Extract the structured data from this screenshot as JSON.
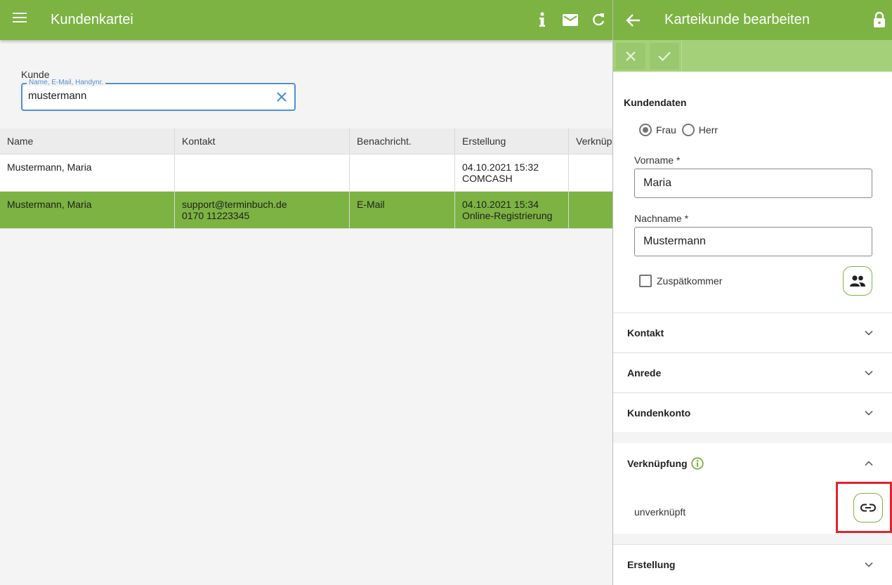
{
  "app": {
    "title": "Kundenkartei",
    "accent": "#7cb342",
    "icons": [
      "menu-icon",
      "info-icon",
      "mail-icon",
      "refresh-icon"
    ]
  },
  "search": {
    "label": "Kunde",
    "floating_label": "Name, E-Mail, Handynr.",
    "value": "mustermann"
  },
  "table": {
    "columns": [
      "Name",
      "Kontakt",
      "Benachricht.",
      "Erstellung",
      "Verknüp"
    ],
    "rows": [
      {
        "name": "Mustermann, Maria",
        "contact_1": "",
        "contact_2": "",
        "notify": "",
        "created_1": "04.10.2021 15:32",
        "created_2": "COMCASH",
        "link": "",
        "selected": false
      },
      {
        "name": "Mustermann, Maria",
        "contact_1": "support@terminbuch.de",
        "contact_2": "0170 11223345",
        "notify": "E-Mail",
        "created_1": "04.10.2021 15:34",
        "created_2": "Online-Registrierung",
        "link": "",
        "selected": true
      }
    ]
  },
  "panel": {
    "title": "Karteikunde bearbeiten",
    "section_title": "Kundendaten",
    "gender": {
      "options": [
        "Frau",
        "Herr"
      ],
      "selected": "Frau"
    },
    "first_name_label": "Vorname *",
    "first_name": "Maria",
    "last_name_label": "Nachname *",
    "last_name": "Mustermann",
    "late_label": "Zuspätkommer",
    "late_checked": false,
    "sections": [
      "Kontakt",
      "Anrede",
      "Kundenkonto"
    ],
    "link_section": "Verknüpfung",
    "link_status": "unverknüpft",
    "last_section": "Erstellung",
    "highlight_color": "#e0232f"
  }
}
